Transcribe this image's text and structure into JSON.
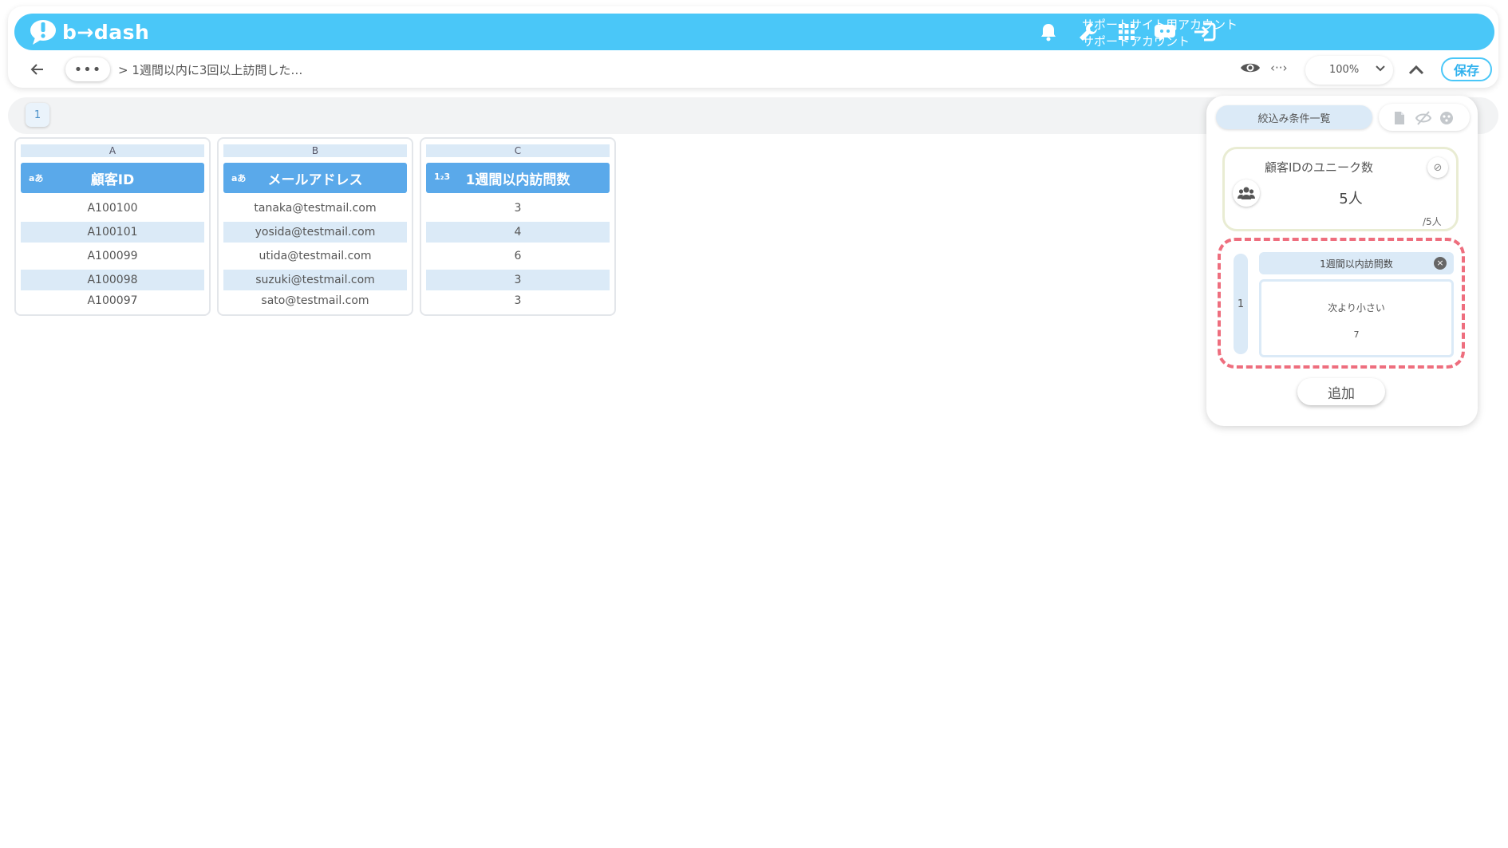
{
  "brand": {
    "logo_text": "b→dash",
    "primary": "#4ac7f8",
    "column_header": "#5aa9ea",
    "alt_row": "#dbeaf7",
    "highlight": "#ee6e7e"
  },
  "header": {
    "account_line1": "サポートサイト用アカウント",
    "account_line2": "サポートアカウント",
    "icons": [
      "bell-icon",
      "wrench-icon",
      "grid-icon",
      "chat-bot-icon",
      "logout-icon"
    ]
  },
  "toolbar": {
    "more_label": "•••",
    "breadcrumb": "> 1週間以内に3回以上訪問した…",
    "code_label": "‹··›",
    "zoom": "100%",
    "save_label": "保存"
  },
  "sheets": {
    "tabs": [
      "1"
    ]
  },
  "columns": [
    {
      "letter": "A",
      "type_label": "aあ",
      "name": "顧客ID",
      "rows": [
        "A100100",
        "A100101",
        "A100099",
        "A100098",
        "A100097"
      ]
    },
    {
      "letter": "B",
      "type_label": "aあ",
      "name": "メールアドレス",
      "rows": [
        "tanaka@testmail.com",
        "yosida@testmail.com",
        "utida@testmail.com",
        "suzuki@testmail.com",
        "sato@testmail.com"
      ]
    },
    {
      "letter": "C",
      "type_label": "1₂3",
      "name": "1週間以内訪問数",
      "rows": [
        "3",
        "4",
        "6",
        "3",
        "3"
      ]
    }
  ],
  "filter_panel": {
    "title": "絞込み条件一覧",
    "stat": {
      "title": "顧客IDのユニーク数",
      "value": "5人",
      "total": "/5人"
    },
    "conditions": [
      {
        "index": "1",
        "field": "1週間以内訪問数",
        "operator": "次より小さい",
        "value": "7"
      }
    ],
    "add_label": "追加"
  }
}
